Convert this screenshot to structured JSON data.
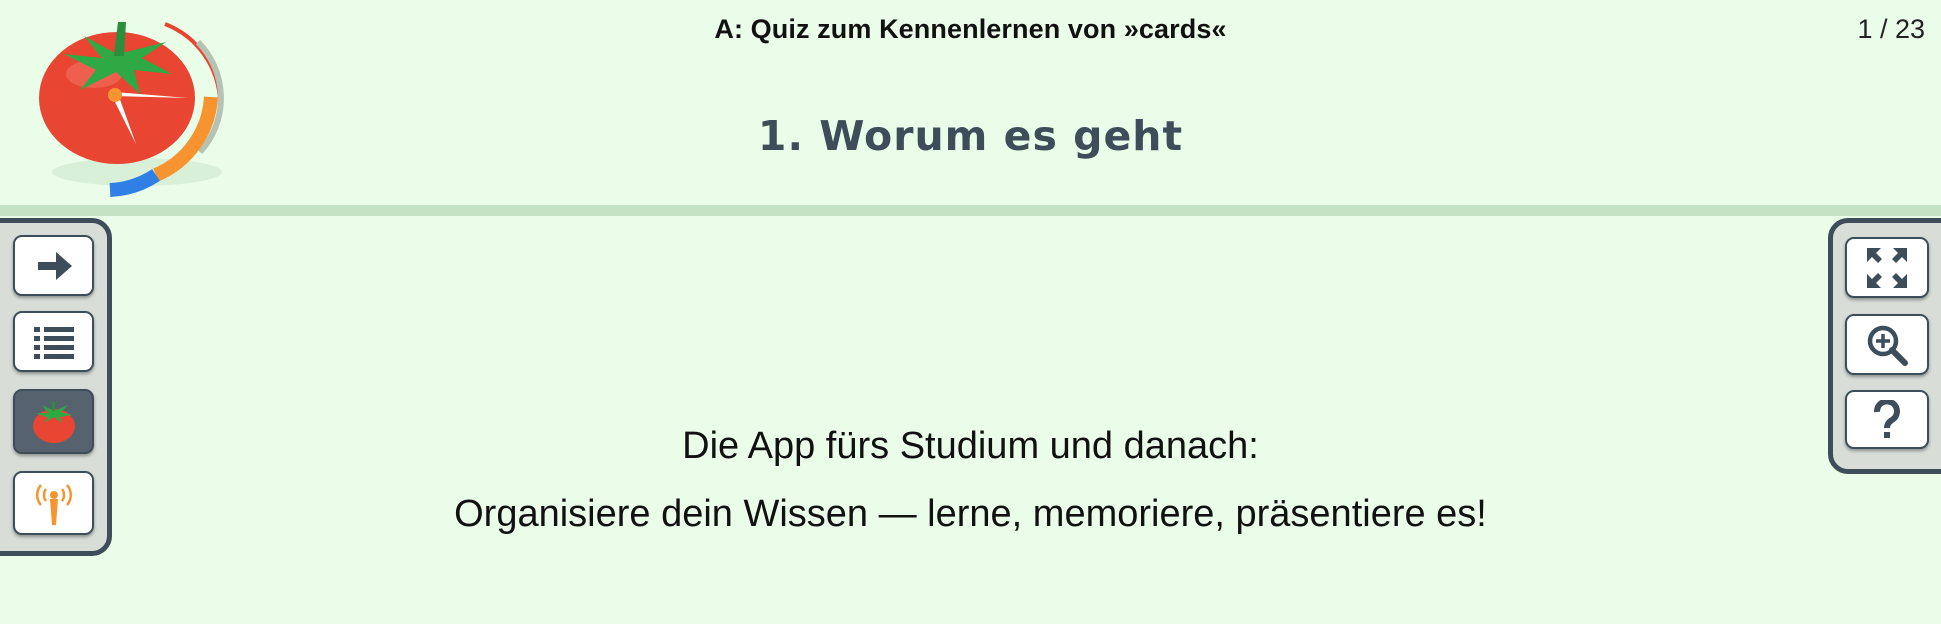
{
  "header": {
    "deck_title": "A: Quiz zum Kennenlernen von »cards«",
    "page_counter": "1 / 23"
  },
  "slide": {
    "title": "1. Worum es geht",
    "lines": [
      "Die App fürs Studium und danach:",
      "Organisiere dein Wissen — lerne, memoriere, präsentiere es!"
    ]
  },
  "left_toolbar": [
    {
      "name": "next-button",
      "icon": "arrow-right-icon"
    },
    {
      "name": "list-button",
      "icon": "list-icon"
    },
    {
      "name": "pomodoro-button",
      "icon": "tomato-icon",
      "active": true
    },
    {
      "name": "broadcast-button",
      "icon": "broadcast-icon"
    }
  ],
  "right_toolbar": [
    {
      "name": "fullscreen-button",
      "icon": "expand-icon"
    },
    {
      "name": "zoom-button",
      "icon": "zoom-in-icon"
    },
    {
      "name": "help-button",
      "icon": "question-icon"
    }
  ],
  "colors": {
    "background": "#eafde8",
    "accent_dark": "#3d4d59",
    "tomato": "#e84533",
    "leaf": "#2fa944",
    "orange": "#f7942f",
    "blue": "#2f7fe6"
  }
}
